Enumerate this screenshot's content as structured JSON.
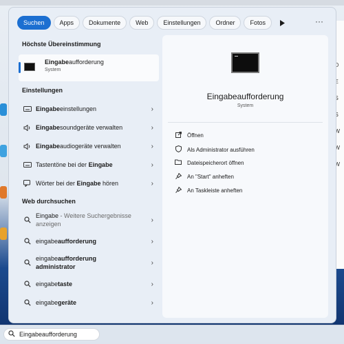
{
  "background_window": {
    "rows": [
      "ot",
      "ot",
      "eD",
      "eE",
      "eS",
      "eS",
      "eW",
      "eW",
      "eW"
    ]
  },
  "tabs": [
    "Suchen",
    "Apps",
    "Dokumente",
    "Web",
    "Einstellungen",
    "Ordner",
    "Fotos"
  ],
  "more_label": "···",
  "left": {
    "best_match_heading": "Höchste Übereinstimmung",
    "best_match": {
      "title_bold": "Eingabe",
      "title_rest": "aufforderung",
      "subtitle": "System"
    },
    "settings_heading": "Einstellungen",
    "settings": [
      {
        "icon": "keyboard-icon",
        "bold": "Eingabe",
        "rest": "einstellungen"
      },
      {
        "icon": "speaker-icon",
        "bold": "Eingabe",
        "rest": "soundgeräte verwalten"
      },
      {
        "icon": "speaker-icon",
        "bold": "Eingabe",
        "rest": "audiogeräte verwalten"
      },
      {
        "icon": "keyboard-icon",
        "pre": "Tastentöne bei der ",
        "bold": "Eingabe"
      },
      {
        "icon": "speech-icon",
        "pre": "Wörter bei der ",
        "bold": "Eingabe",
        "rest": " hören"
      }
    ],
    "web_heading": "Web durchsuchen",
    "web": [
      {
        "pre": "Eingabe",
        "sub": " - Weitere Suchergebnisse anzeigen"
      },
      {
        "pre": "eingabe",
        "bold": "aufforderung"
      },
      {
        "pre": "eingabe",
        "bold": "aufforderung",
        "bold2": "administrator"
      },
      {
        "pre": "eingabe",
        "bold": "taste"
      },
      {
        "pre": "eingabe",
        "bold": "geräte"
      }
    ]
  },
  "right": {
    "title": "Eingabeaufforderung",
    "subtitle": "System",
    "actions": [
      {
        "icon": "open-icon",
        "label": "Öffnen"
      },
      {
        "icon": "shield-icon",
        "label": "Als Administrator ausführen"
      },
      {
        "icon": "folder-icon",
        "label": "Dateispeicherort öffnen"
      },
      {
        "icon": "pin-icon",
        "label": "An \"Start\" anheften"
      },
      {
        "icon": "pin-icon",
        "label": "An Taskleiste anheften"
      }
    ]
  },
  "search": {
    "value": "Eingabeaufforderung"
  },
  "colors": {
    "accent": "#1c6fd1",
    "panel": "#e8eef6",
    "detail": "#f7f9fc"
  }
}
